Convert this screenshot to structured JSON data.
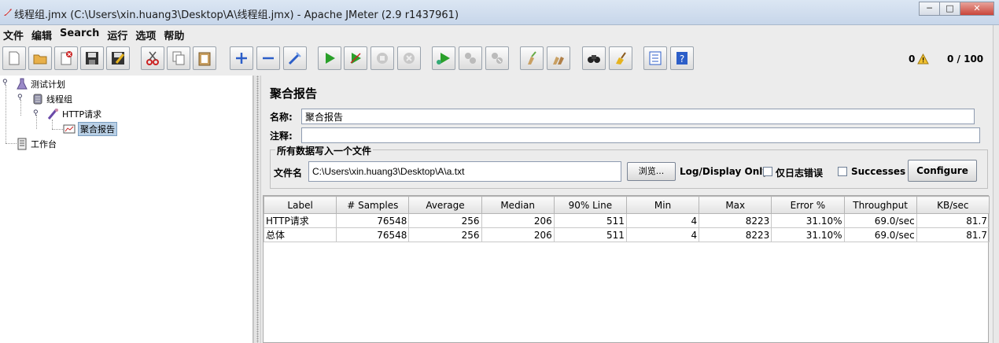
{
  "window": {
    "title": "线程组.jmx (C:\\Users\\xin.huang3\\Desktop\\A\\线程组.jmx) - Apache JMeter (2.9 r1437961)",
    "minimize": "─",
    "maximize": "□",
    "close": "✕"
  },
  "menu": [
    "文件",
    "编辑",
    "Search",
    "运行",
    "选项",
    "帮助"
  ],
  "toolbar": {
    "buttons": [
      "new",
      "open",
      "close",
      "save",
      "save-as",
      "cut",
      "copy",
      "paste",
      "expand",
      "collapse",
      "toggle",
      "start",
      "start-no-timers",
      "stop",
      "shutdown",
      "remote-start",
      "remote-stop",
      "remote-shutdown",
      "clear",
      "clear-all",
      "search",
      "reset-search",
      "function-helper",
      "help"
    ],
    "error_count": "0",
    "threads": "0 / 100"
  },
  "tree": {
    "items": [
      {
        "label": "测试计划",
        "icon": "test-plan-icon"
      },
      {
        "label": "线程组",
        "icon": "thread-group-icon"
      },
      {
        "label": "HTTP请求",
        "icon": "sampler-icon"
      },
      {
        "label": "聚合报告",
        "icon": "listener-icon"
      },
      {
        "label": "工作台",
        "icon": "workbench-icon"
      }
    ]
  },
  "report": {
    "title": "聚合报告",
    "name_label": "名称:",
    "name_value": "聚合报告",
    "comment_label": "注释:",
    "comment_value": "",
    "file_section": "所有数据写入一个文件",
    "filename_label": "文件名",
    "filename_value": "C:\\Users\\xin.huang3\\Desktop\\A\\a.txt",
    "browse": "浏览...",
    "log_display": "Log/Display Only:",
    "errors_only": "仅日志错误",
    "successes": "Successes",
    "configure": "Configure"
  },
  "table": {
    "columns": [
      "Label",
      "# Samples",
      "Average",
      "Median",
      "90% Line",
      "Min",
      "Max",
      "Error %",
      "Throughput",
      "KB/sec"
    ],
    "rows": [
      [
        "HTTP请求",
        "76548",
        "256",
        "206",
        "511",
        "4",
        "8223",
        "31.10%",
        "69.0/sec",
        "81.7"
      ],
      [
        "总体",
        "76548",
        "256",
        "206",
        "511",
        "4",
        "8223",
        "31.10%",
        "69.0/sec",
        "81.7"
      ]
    ]
  },
  "colors": {
    "selection": "#b8cfe5",
    "background": "#ececec"
  }
}
